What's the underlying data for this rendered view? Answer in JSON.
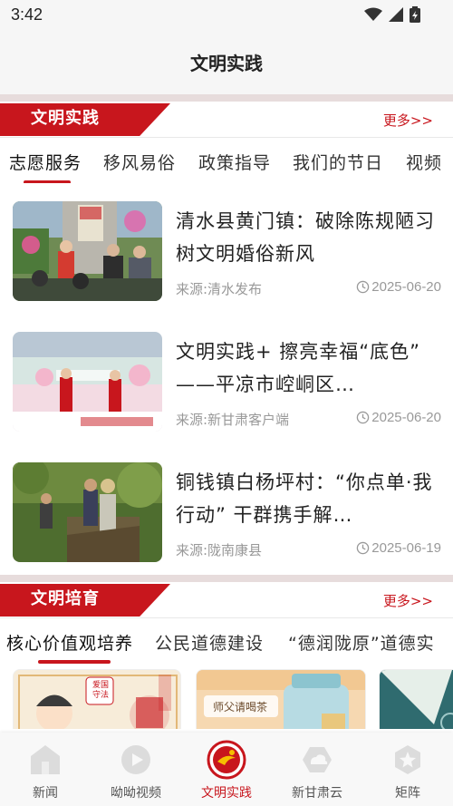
{
  "status": {
    "time": "3:42"
  },
  "nav": {
    "title": "文明实践"
  },
  "section1": {
    "title": "文明实践",
    "more": "更多>>",
    "tabs": [
      "志愿服务",
      "移风易俗",
      "政策指导",
      "我们的节日",
      "视频"
    ],
    "active_tab": 0,
    "news": [
      {
        "title": "清水县黄门镇：破除陈规陋习树文明婚俗新风",
        "source": "来源:清水发布",
        "date": "2025-06-20"
      },
      {
        "title": "文明实践+ 擦亮幸福“底色” ——平凉市崆峒区…",
        "source": "来源:新甘肃客户端",
        "date": "2025-06-20"
      },
      {
        "title": "铜钱镇白杨坪村：“你点单·我行动” 干群携手解…",
        "source": "来源:陇南康县",
        "date": "2025-06-19"
      }
    ]
  },
  "section2": {
    "title": "文明培育",
    "more": "更多>>",
    "tabs": [
      "核心价值观培养",
      "公民道德建设",
      "“德润陇原”道德实"
    ],
    "active_tab": 0,
    "card_texts": [
      "爱国守法",
      "师父请喝茶"
    ]
  },
  "bottom_nav": [
    {
      "label": "新闻",
      "icon": "house-icon",
      "active": false
    },
    {
      "label": "呦呦视频",
      "icon": "play-icon",
      "active": false
    },
    {
      "label": "文明实践",
      "icon": "civilization-logo-icon",
      "active": true
    },
    {
      "label": "新甘肃云",
      "icon": "cloud-icon",
      "active": false
    },
    {
      "label": "矩阵",
      "icon": "star-icon",
      "active": false
    }
  ],
  "colors": {
    "accent": "#c8161d",
    "inactive": "#555555"
  }
}
